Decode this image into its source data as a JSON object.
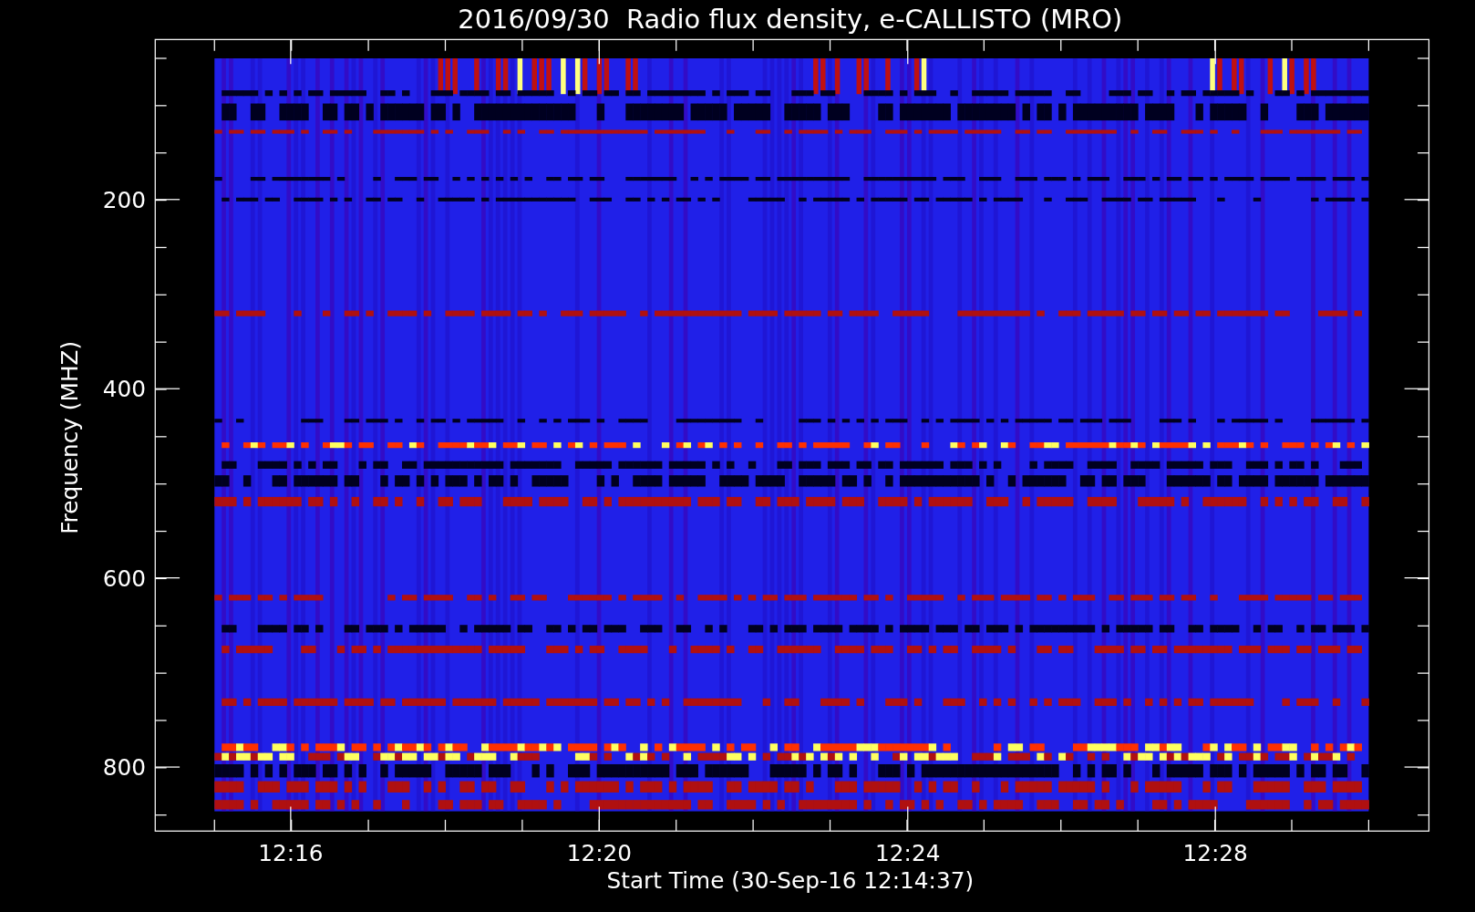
{
  "title": "2016/09/30  Radio flux density, e-CALLISTO (MRO)",
  "x_axis": {
    "label": "Start Time (30-Sep-16 12:14:37)",
    "ticks": [
      "12:16",
      "12:20",
      "12:24",
      "12:28"
    ]
  },
  "y_axis": {
    "label": "Frequency (MHZ)",
    "ticks": [
      "200",
      "400",
      "600",
      "800"
    ]
  }
}
